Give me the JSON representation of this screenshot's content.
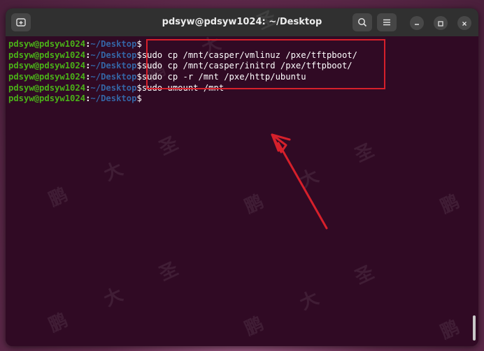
{
  "window": {
    "title": "pdsyw@pdsyw1024: ~/Desktop"
  },
  "terminal": {
    "prompt_user": "pdsyw@pdsyw1024",
    "prompt_colon": ":",
    "prompt_path": "~/Desktop",
    "prompt_symbol": "$",
    "lines": [
      "",
      "sudo cp /mnt/casper/vmlinuz /pxe/tftpboot/",
      "sudo cp /mnt/casper/initrd /pxe/tftpboot/",
      "sudo cp -r /mnt /pxe/http/ubuntu",
      "sudo umount /mnt",
      ""
    ]
  },
  "watermark": "鹏 大 圣",
  "colors": {
    "terminal_bg": "#300a24",
    "prompt_user": "#4ab118",
    "prompt_path": "#3465a4",
    "highlight_box": "#d6202b",
    "arrow": "#d6202b"
  },
  "icons": {
    "new_tab": "new-tab-icon",
    "search": "search-icon",
    "menu": "hamburger-menu-icon",
    "minimize": "minimize-icon",
    "maximize": "maximize-icon",
    "close": "close-icon"
  }
}
